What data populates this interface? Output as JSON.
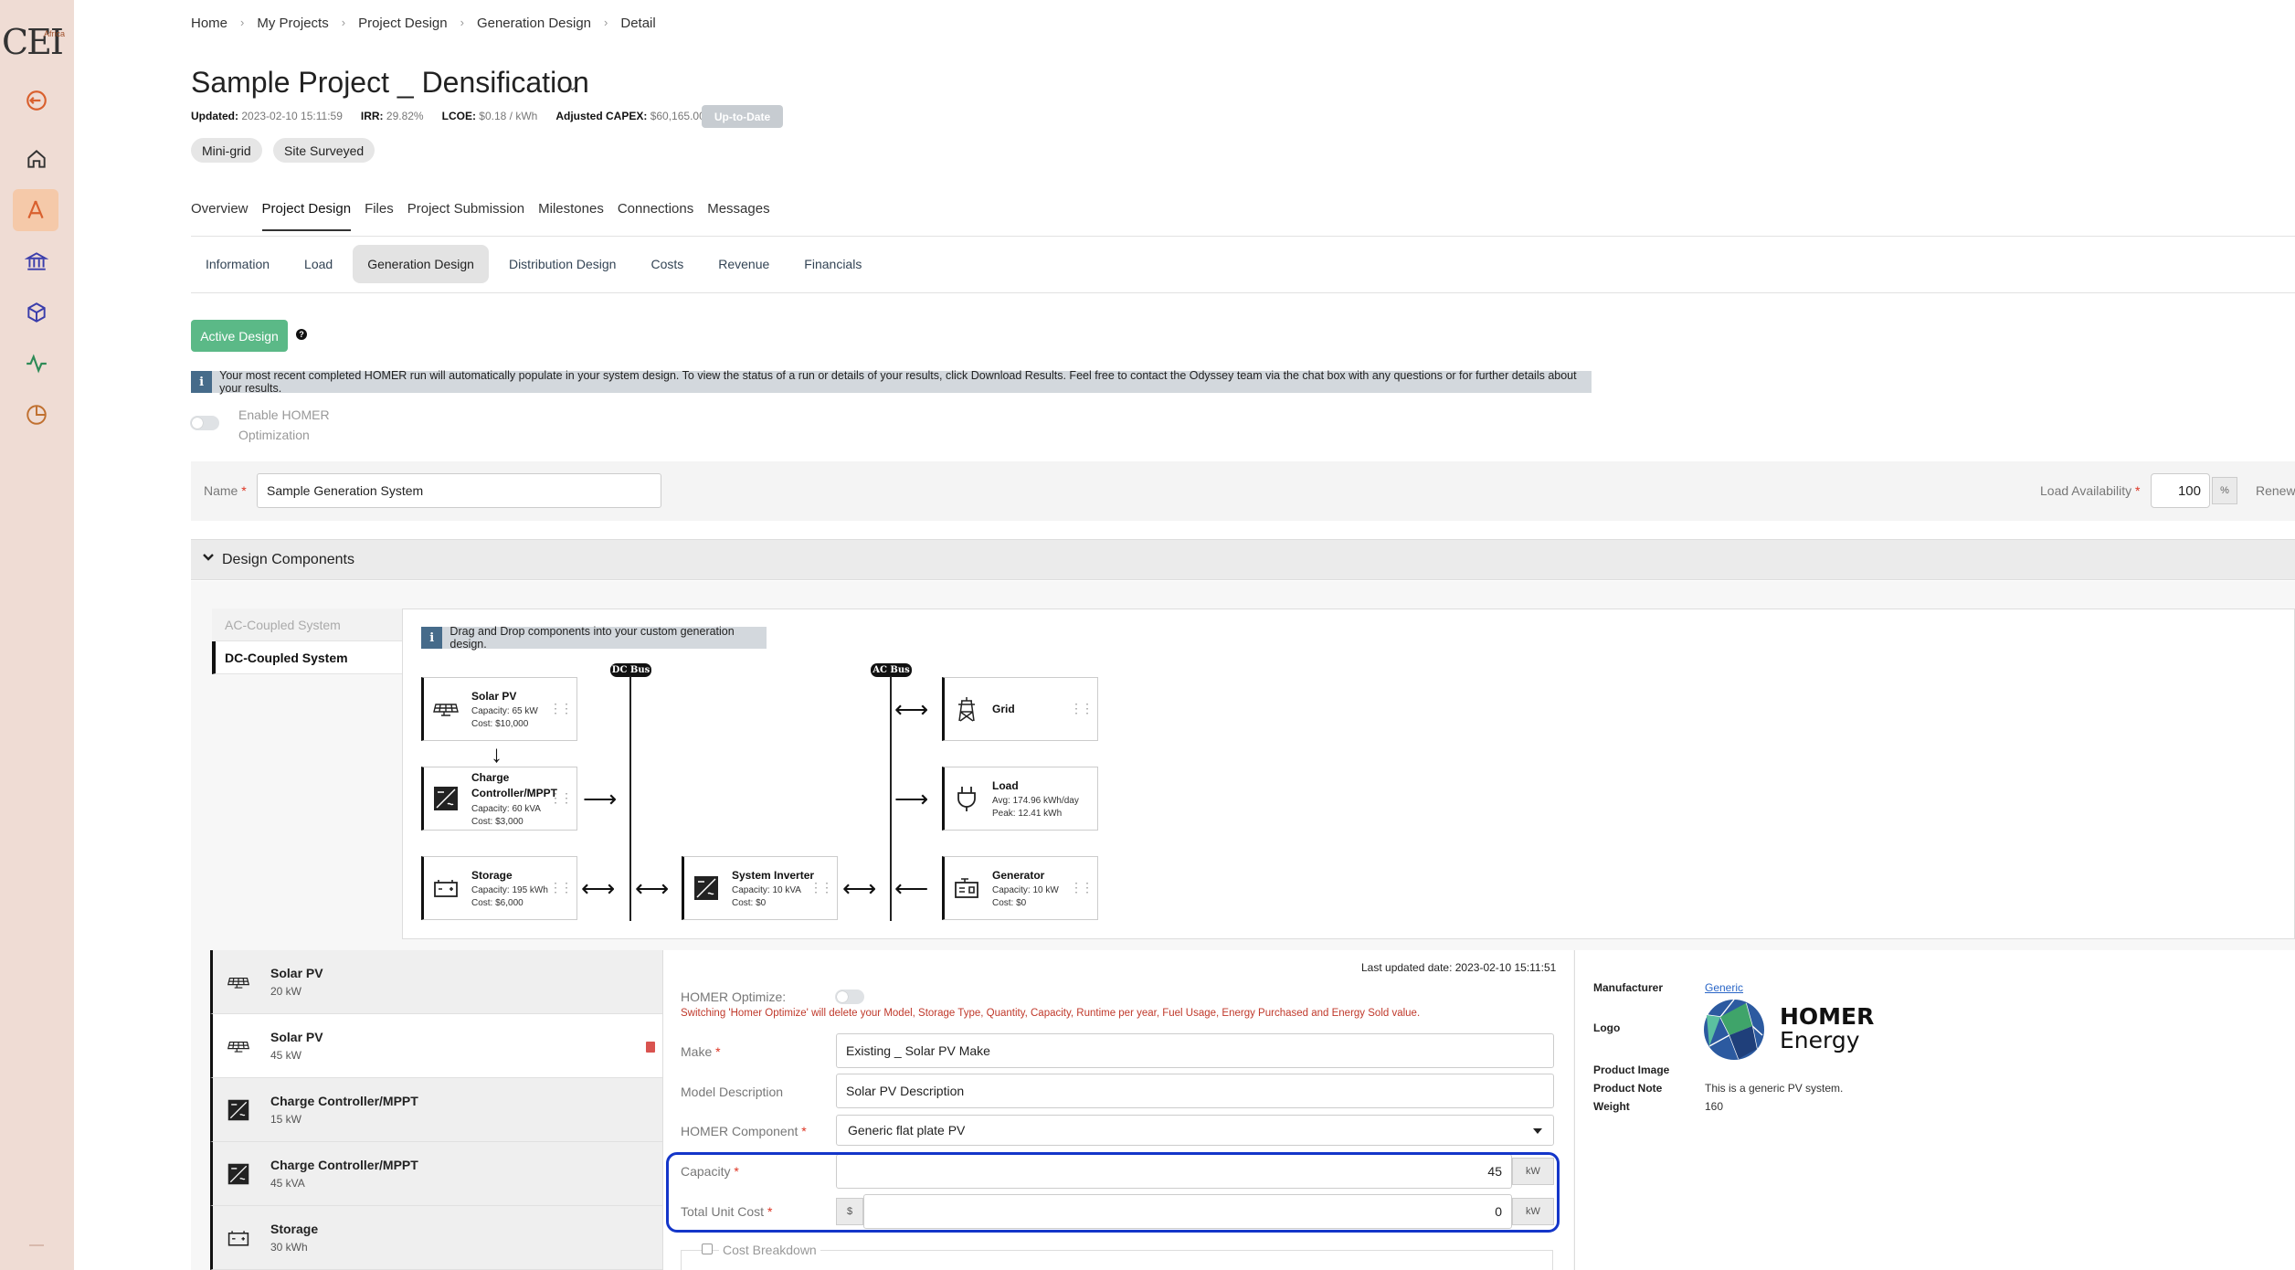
{
  "app": {
    "logo_text": "CEI",
    "logo_sub": "Africa"
  },
  "sidebar": {
    "items": [
      {
        "icon": "logout-icon",
        "color": "#d9602e"
      },
      {
        "icon": "home-icon"
      },
      {
        "icon": "design-compass-icon",
        "active": true
      },
      {
        "icon": "bank-icon"
      },
      {
        "icon": "package-icon"
      },
      {
        "icon": "activity-icon"
      },
      {
        "icon": "pie-chart-icon"
      }
    ]
  },
  "breadcrumb": [
    "Home",
    "My Projects",
    "Project Design",
    "Generation Design",
    "Detail"
  ],
  "project": {
    "title": "Sample Project _ Densification",
    "updated_label": "Updated:",
    "updated_value": "2023-02-10 15:11:59",
    "irr_label": "IRR:",
    "irr_value": "29.82%",
    "lcoe_label": "LCOE:",
    "lcoe_value": "$0.18 / kWh",
    "capex_label": "Adjusted CAPEX:",
    "capex_value": "$60,165.00",
    "status": "Up-to-Date",
    "tags": [
      "Mini-grid",
      "Site Surveyed"
    ]
  },
  "tabs_main": [
    "Overview",
    "Project Design",
    "Files",
    "Project Submission",
    "Milestones",
    "Connections",
    "Messages"
  ],
  "tabs_main_active": "Project Design",
  "tabs_sub": [
    "Information",
    "Load",
    "Generation Design",
    "Distribution Design",
    "Costs",
    "Revenue",
    "Financials"
  ],
  "tabs_sub_active": "Generation Design",
  "active_design_label": "Active Design",
  "info_message": "Your most recent completed HOMER run will automatically populate in your system design. To view the status of a run or details of your results, click Download Results. Feel free to contact the Odyssey team via the chat box with any questions or for further details about your results.",
  "enable_homer_label": "Enable HOMER Optimization",
  "name_field": {
    "label": "Name",
    "value": "Sample Generation System"
  },
  "load_availability": {
    "label": "Load Availability",
    "value": "100",
    "unit": "%"
  },
  "renew_label": "Renew",
  "design_components_label": "Design Components",
  "system_tabs": [
    "AC-Coupled System",
    "DC-Coupled System"
  ],
  "dnd_message": "Drag and Drop components into your custom generation design.",
  "diagram": {
    "dc_bus": "DC Bus",
    "ac_bus": "AC Bus",
    "components": {
      "solar": {
        "name": "Solar PV",
        "l1": "Capacity: 65 kW",
        "l2": "Cost: $10,000"
      },
      "charge": {
        "name": "Charge Controller/MPPT",
        "l1": "Capacity: 60 kVA",
        "l2": "Cost: $3,000"
      },
      "storage": {
        "name": "Storage",
        "l1": "Capacity: 195 kWh",
        "l2": "Cost: $6,000"
      },
      "inverter": {
        "name": "System Inverter",
        "l1": "Capacity: 10 kVA",
        "l2": "Cost: $0"
      },
      "grid": {
        "name": "Grid"
      },
      "load": {
        "name": "Load",
        "l1": "Avg: 174.96 kWh/day",
        "l2": "Peak: 12.41 kWh"
      },
      "generator": {
        "name": "Generator",
        "l1": "Capacity: 10 kW",
        "l2": "Cost: $0"
      }
    }
  },
  "component_list": [
    {
      "name": "Solar PV",
      "size": "20 kW",
      "icon": "solar-panel-icon"
    },
    {
      "name": "Solar PV",
      "size": "45 kW",
      "icon": "solar-panel-icon",
      "selected": true
    },
    {
      "name": "Charge Controller/MPPT",
      "size": "15 kW",
      "icon": "charge-controller-icon"
    },
    {
      "name": "Charge Controller/MPPT",
      "size": "45 kVA",
      "icon": "charge-controller-icon"
    },
    {
      "name": "Storage",
      "size": "30 kWh",
      "icon": "battery-icon"
    }
  ],
  "form": {
    "last_updated": "Last updated date: 2023-02-10 15:11:51",
    "homer_optimize_label": "HOMER Optimize:",
    "homer_warning": "Switching 'Homer Optimize' will delete your Model, Storage Type, Quantity, Capacity, Runtime per year, Fuel Usage, Energy Purchased and Energy Sold value.",
    "make_label": "Make",
    "make_value": "Existing _ Solar PV Make",
    "model_label": "Model Description",
    "model_value": "Solar PV Description",
    "homer_component_label": "HOMER Component",
    "homer_component_value": "Generic flat plate PV",
    "capacity_label": "Capacity",
    "capacity_value": "45",
    "capacity_unit": "kW",
    "unit_cost_label": "Total Unit Cost",
    "unit_cost_prefix": "$",
    "unit_cost_value": "0",
    "unit_cost_unit": "kW",
    "cost_breakdown_label": "Cost Breakdown"
  },
  "product": {
    "manufacturer_label": "Manufacturer",
    "manufacturer_value": "Generic",
    "logo_label": "Logo",
    "logo_text_1": "HOMER",
    "logo_text_2": "Energy",
    "image_label": "Product Image",
    "note_label": "Product Note",
    "note_value": "This is a generic PV system.",
    "weight_label": "Weight",
    "weight_value": "160"
  },
  "colors": {
    "accent_green": "#5bb987",
    "highlight_blue": "#1436c9",
    "sidebar_bg": "#efdcd4",
    "danger": "#d9534f"
  }
}
